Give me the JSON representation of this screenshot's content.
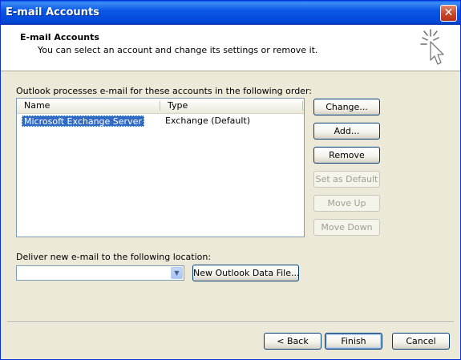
{
  "window": {
    "title": "E-mail Accounts"
  },
  "header": {
    "title": "E-mail Accounts",
    "subtitle": "You can select an account and change its settings or remove it."
  },
  "accounts": {
    "label": "Outlook processes e-mail for these accounts in the following order:",
    "columns": [
      "Name",
      "Type"
    ],
    "rows": [
      {
        "name": "Microsoft Exchange Server",
        "type": "Exchange (Default)",
        "selected": true
      }
    ]
  },
  "side_buttons": {
    "change": "Change...",
    "add": "Add...",
    "remove": "Remove",
    "set_default": "Set as Default",
    "move_up": "Move Up",
    "move_down": "Move Down"
  },
  "deliver": {
    "label": "Deliver new e-mail to the following location:",
    "selected_value": "",
    "new_data_file": "New Outlook Data File..."
  },
  "footer": {
    "back": "< Back",
    "finish": "Finish",
    "cancel": "Cancel"
  },
  "icons": {
    "close": "close-icon",
    "wizard": "sparkle-cursor-icon",
    "dropdown": "chevron-down-icon"
  },
  "colors": {
    "titlebar": "#0a58e6",
    "dialog_bg": "#ece9d8",
    "selection": "#316ac5"
  }
}
